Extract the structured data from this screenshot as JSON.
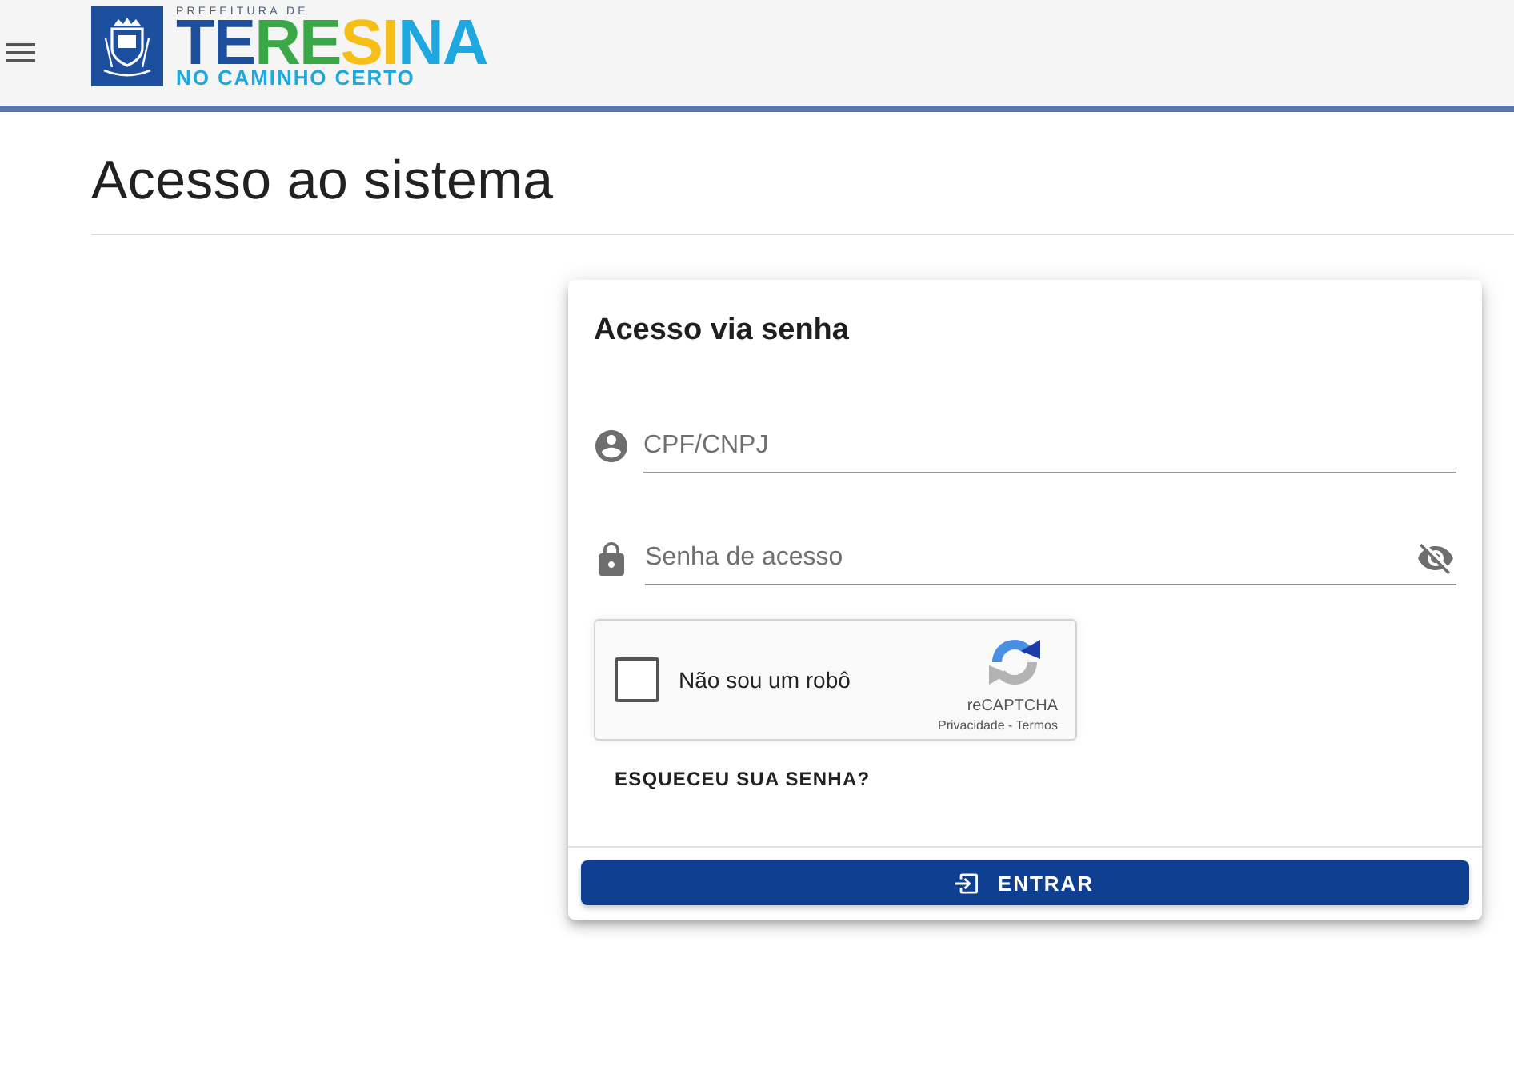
{
  "header": {
    "logo": {
      "caption": "PREFEITURA DE",
      "wordmark": [
        {
          "text": "TE",
          "color": "#1d4f9f"
        },
        {
          "text": "RE",
          "color": "#3ba847"
        },
        {
          "text": "SI",
          "color": "#f6bf17"
        },
        {
          "text": "NA",
          "color": "#1fa8e0"
        }
      ],
      "tagline": "NO CAMINHO CERTO"
    }
  },
  "page_title": "Acesso ao sistema",
  "login_card": {
    "title": "Acesso via senha",
    "fields": [
      {
        "kind": "text",
        "placeholder": "CPF/CNPJ"
      },
      {
        "kind": "password",
        "placeholder": "Senha de acesso",
        "revealed": false
      }
    ],
    "captcha": {
      "label": "Não sou um robô",
      "checked": false,
      "brand": "reCAPTCHA",
      "footer": "Privacidade - Termos"
    },
    "forgot_link": "ESQUECEU SUA SENHA?",
    "submit_button": "ENTRAR"
  }
}
